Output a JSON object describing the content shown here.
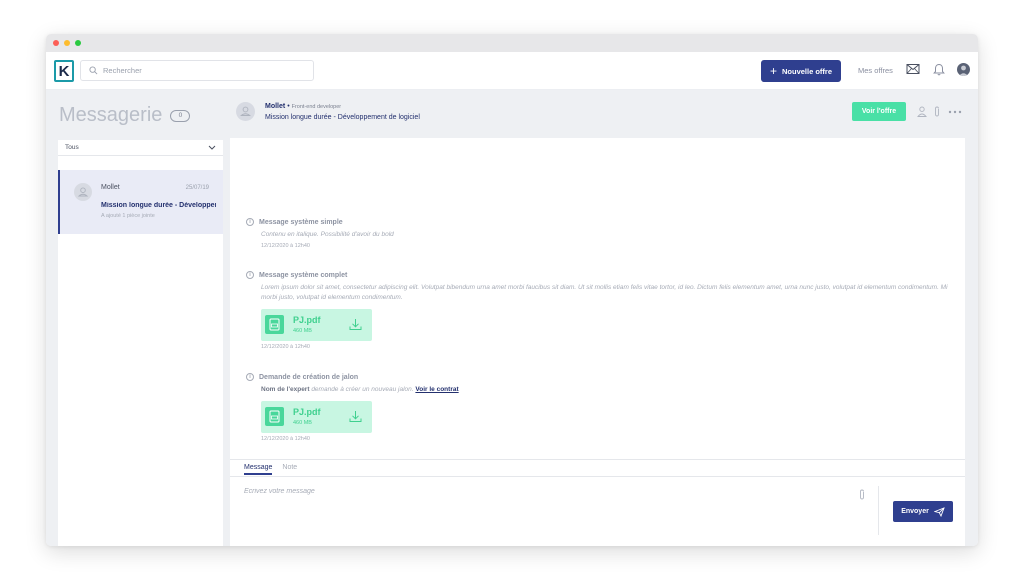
{
  "header": {
    "logo_letter": "K",
    "search_placeholder": "Rechercher",
    "new_offer_label": "Nouvelle offre",
    "my_offers_label": "Mes offres"
  },
  "sidebar": {
    "title": "Messagerie",
    "unread_count": "0",
    "filter_value": "Tous",
    "conversations": [
      {
        "name": "Mollet",
        "date": "25/07/19",
        "subject": "Mission longue durée - Développement de logiciel",
        "note": "A ajouté 1 pièce jointe"
      }
    ]
  },
  "conversation": {
    "name": "Mollet",
    "separator": "•",
    "role": "Front-end developer",
    "mission": "Mission longue durée - Développement de logiciel",
    "view_offer_label": "Voir l'offre"
  },
  "messages": [
    {
      "title": "Message système simple",
      "body": "Contenu en italique. Possibilité d'avoir du bold",
      "time": "12/12/2020 à 12h40"
    },
    {
      "title": "Message système complet",
      "body": "Lorem ipsum dolor sit amet, consectetur adipiscing elit. Volutpat bibendum urna amet morbi faucibus sit diam. Ut sit mollis etiam felis vitae tortor, id leo. Dictum felis elementum amet, urna nunc justo, volutpat id elementum condimentum. Mi morbi justo, volutpat id elementum condimentum.",
      "attachment": {
        "name": "PJ.pdf",
        "size": "460 MB"
      },
      "time": "12/12/2020 à 12h40"
    },
    {
      "title": "Demande de création de jalon",
      "expert": "Nom de l'expert",
      "body": " demande à créer un nouveau jalon. ",
      "link": "Voir le contrat",
      "attachment": {
        "name": "PJ.pdf",
        "size": "460 MB"
      },
      "time": "12/12/2020 à 12h40"
    }
  ],
  "composer": {
    "tabs": [
      "Message",
      "Note"
    ],
    "placeholder": "Ecrivez votre message",
    "send_label": "Envoyer"
  },
  "colors": {
    "primary": "#2f3f8f",
    "accent_green": "#49e0a6",
    "attachment_bg": "#c8f6e2"
  }
}
